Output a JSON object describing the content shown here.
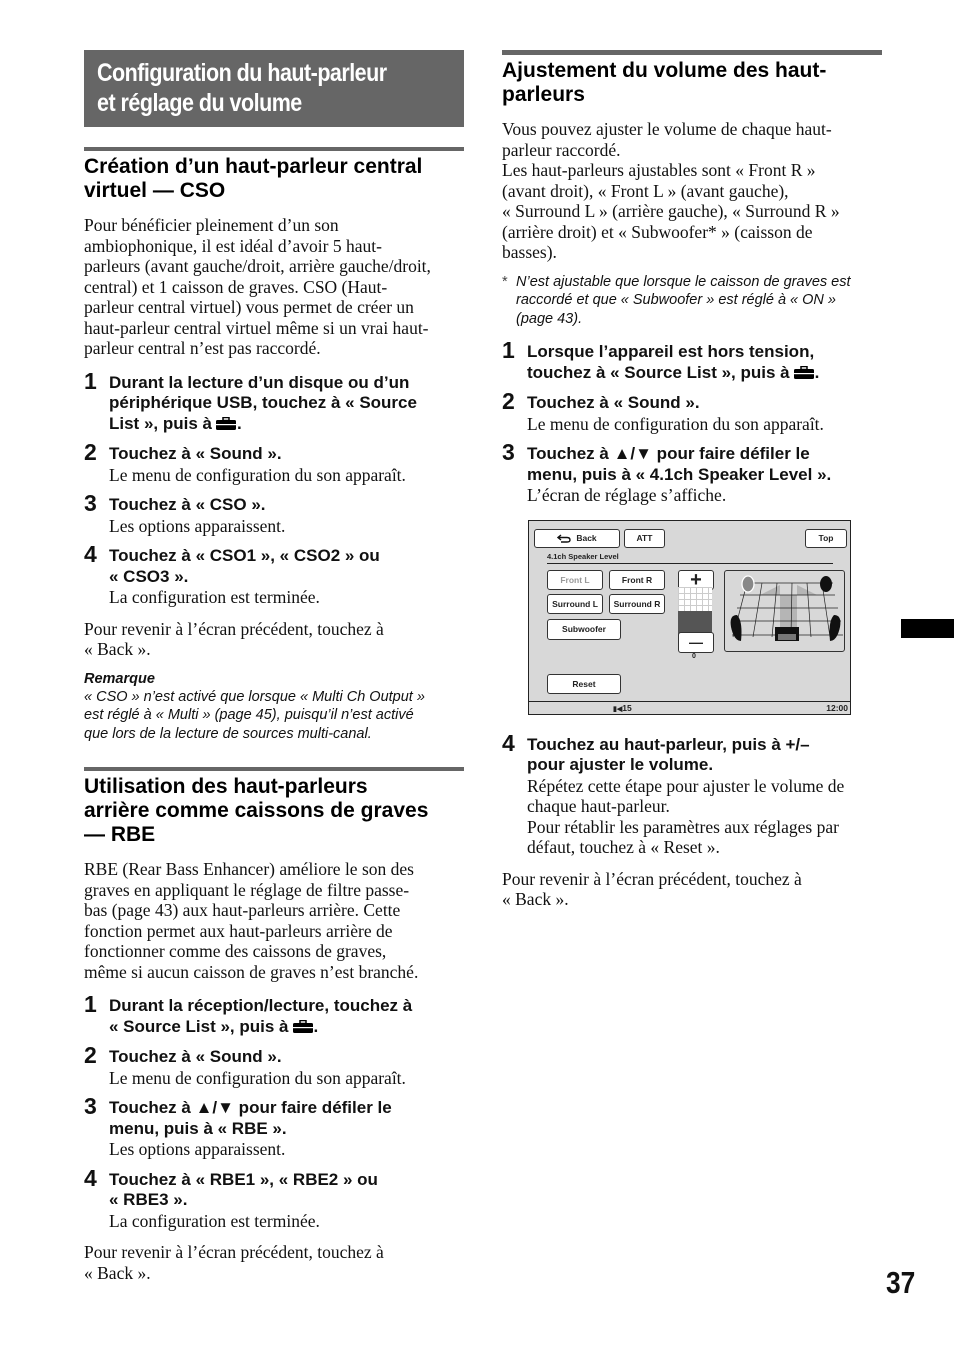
{
  "page_number": "37",
  "main_title": [
    "Configuration du haut-parleur",
    "et réglage du volume"
  ],
  "section_cso": {
    "heading": [
      "Création d’un haut-parleur central",
      "virtuel — CSO"
    ],
    "intro": [
      "Pour bénéficier pleinement d’un son",
      "ambiophonique, il est idéal d’avoir 5 haut-",
      "parleurs (avant gauche/droit, arrière gauche/droit,",
      "central) et 1 caisson de graves. CSO (Haut-",
      "parleur central virtuel) vous permet de créer un",
      "haut-parleur central virtuel même si un vrai haut-",
      "parleur central n’est pas raccordé."
    ],
    "steps": [
      {
        "num": "1",
        "title": [
          "Durant la lecture d’un disque ou d’un",
          "périphérique USB, touchez à « Source",
          "List », puis à"
        ],
        "icon": "toolbox-icon",
        "desc": []
      },
      {
        "num": "2",
        "title": [
          "Touchez à « Sound »."
        ],
        "desc": [
          "Le menu de configuration du son apparaît."
        ]
      },
      {
        "num": "3",
        "title": [
          "Touchez à « CSO »."
        ],
        "desc": [
          "Les options apparaissent."
        ]
      },
      {
        "num": "4",
        "title": [
          "Touchez à « CSO1 », « CSO2 » ou",
          "« CSO3 »."
        ],
        "desc": [
          "La configuration est terminée."
        ]
      }
    ],
    "back_note": [
      "Pour revenir à l’écran précédent, touchez à",
      "« Back »."
    ],
    "remark_title": "Remarque",
    "remark": [
      "« CSO » n’est activé que lorsque « Multi Ch Output »",
      "est réglé à « Multi » (page 45), puisqu’il n’est activé",
      "que lors de la lecture de sources multi-canal."
    ]
  },
  "section_rbe": {
    "heading": [
      "Utilisation des haut-parleurs",
      "arrière comme caissons de graves",
      "— RBE"
    ],
    "intro": [
      "RBE (Rear Bass Enhancer) améliore le son des",
      "graves en appliquant le réglage de filtre passe-",
      "bas (page 43) aux haut-parleurs arrière. Cette",
      "fonction permet aux haut-parleurs arrière de",
      "fonctionner comme des caissons de graves,",
      "même si aucun caisson de graves n’est branché."
    ],
    "steps": [
      {
        "num": "1",
        "title": [
          "Durant la réception/lecture, touchez à",
          "« Source List », puis à"
        ],
        "icon": "toolbox-icon",
        "desc": []
      },
      {
        "num": "2",
        "title": [
          "Touchez à « Sound »."
        ],
        "desc": [
          "Le menu de configuration du son apparaît."
        ]
      },
      {
        "num": "3",
        "title": [
          "Touchez à ▲/▼ pour faire défiler le",
          "menu, puis à « RBE »."
        ],
        "desc": [
          "Les options apparaissent."
        ]
      },
      {
        "num": "4",
        "title": [
          "Touchez à « RBE1 », « RBE2 » ou",
          "« RBE3 »."
        ],
        "desc": [
          "La configuration est terminée."
        ]
      }
    ],
    "back_note": [
      "Pour revenir à l’écran précédent, touchez à",
      "« Back »."
    ]
  },
  "section_volume": {
    "heading": [
      "Ajustement du volume des haut-",
      "parleurs"
    ],
    "intro": [
      "Vous pouvez ajuster le volume de chaque haut-",
      "parleur raccordé.",
      "Les haut-parleurs ajustables sont « Front R »",
      "(avant droit), « Front L » (avant gauche),",
      "« Surround L » (arrière gauche), « Surround R »",
      "(arrière droit) et « Subwoofer* » (caisson de",
      "basses)."
    ],
    "footnote_marker": "*",
    "footnote": [
      "N’est ajustable que lorsque le caisson de graves est",
      "raccordé et que « Subwoofer » est réglé à « ON »",
      "(page 43)."
    ],
    "steps": [
      {
        "num": "1",
        "title": [
          "Lorsque l’appareil est hors tension,",
          "touchez à « Source List », puis à"
        ],
        "icon": "toolbox-icon",
        "desc": []
      },
      {
        "num": "2",
        "title": [
          "Touchez à « Sound »."
        ],
        "desc": [
          "Le menu de configuration du son apparaît."
        ]
      },
      {
        "num": "3",
        "title": [
          "Touchez à ▲/▼ pour faire défiler le",
          "menu, puis à « 4.1ch Speaker Level »."
        ],
        "desc": [
          "L’écran de réglage s’affiche."
        ]
      },
      {
        "num": "4",
        "title": [
          "Touchez au haut-parleur, puis à +/–",
          "pour ajuster le volume."
        ],
        "desc": [
          "Répétez cette étape pour ajuster le volume de",
          "chaque haut-parleur.",
          "Pour rétablir les paramètres aux réglages par",
          "défaut, touchez à « Reset »."
        ]
      }
    ],
    "back_note": [
      "Pour revenir à l’écran précédent, touchez à",
      "« Back »."
    ]
  },
  "device_screen": {
    "back_label": "Back",
    "att_label": "ATT",
    "top_label": "Top",
    "screen_title": "4.1ch Speaker Level",
    "speaker_buttons": {
      "front_l": "Front L",
      "front_r": "Front R",
      "surround_l": "Surround L",
      "surround_r": "Surround R",
      "subwoofer": "Subwoofer"
    },
    "selected_speaker": "Front L",
    "plus_label": "+",
    "minus_label": "—",
    "level_value": "0",
    "reset_label": "Reset",
    "volume": "15",
    "clock": "12:00"
  }
}
